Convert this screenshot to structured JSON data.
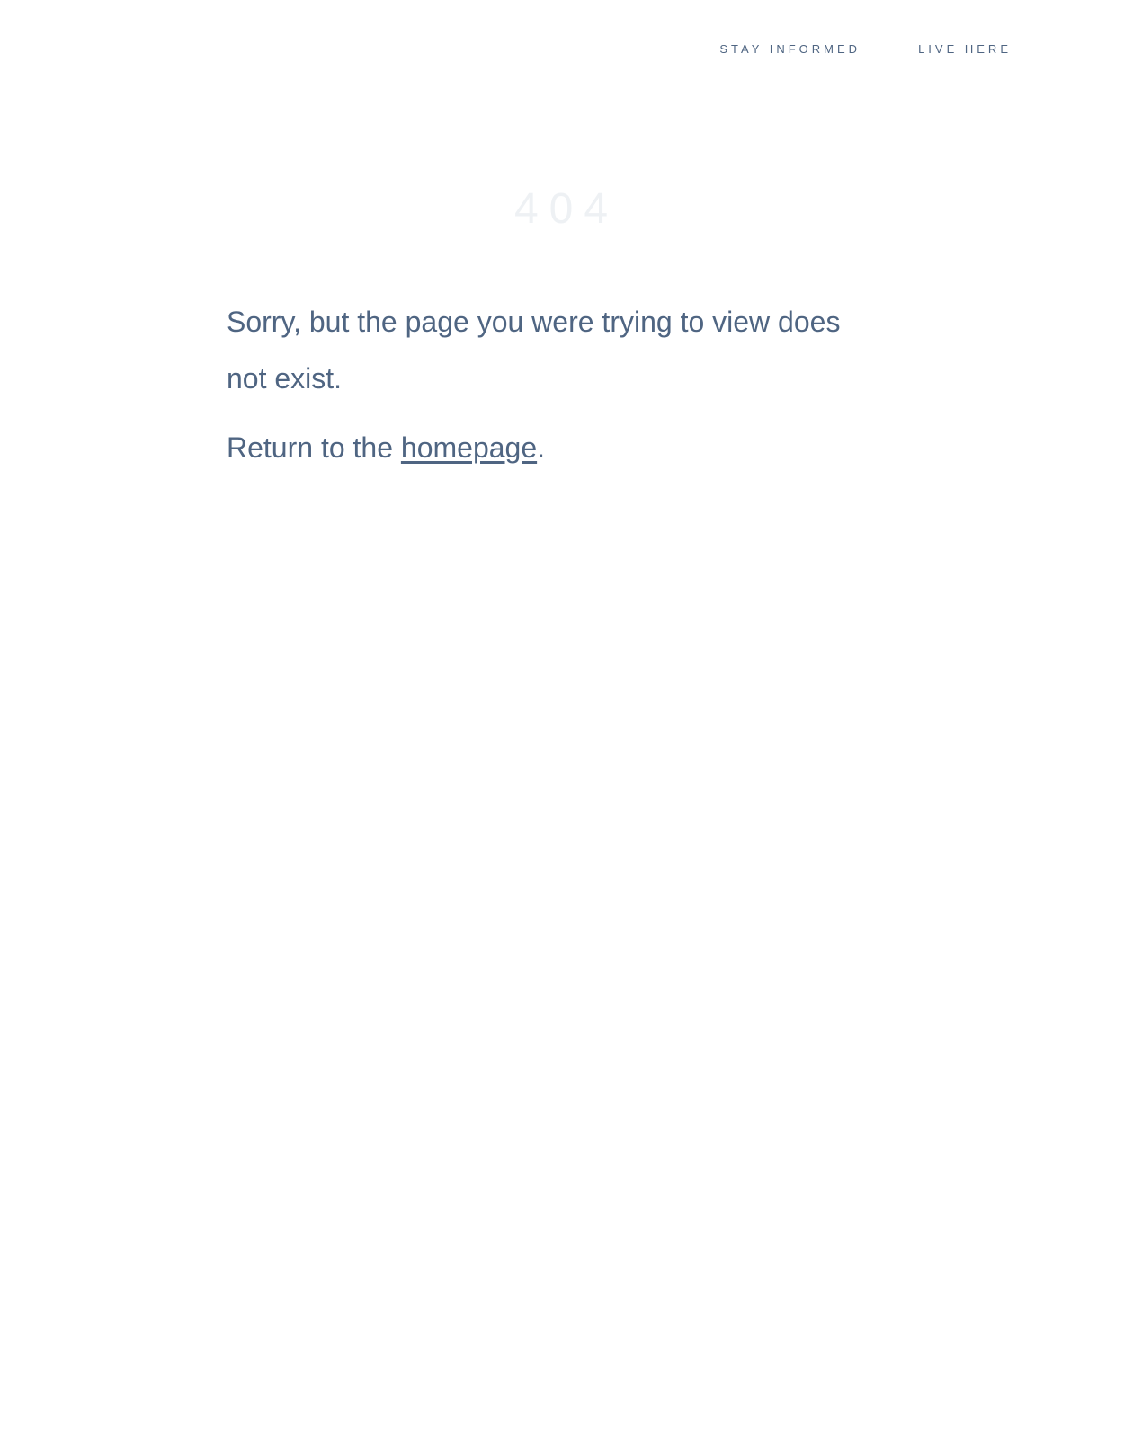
{
  "nav": {
    "items": [
      {
        "label": "STAY INFORMED"
      },
      {
        "label": "LIVE HERE"
      }
    ]
  },
  "error": {
    "code": "404",
    "message": "Sorry, but the page you were trying to view does not exist.",
    "return_prefix": "Return to the ",
    "return_link": "homepage",
    "return_suffix": "."
  },
  "colors": {
    "text": "#4f6582",
    "code": "#eef1f4",
    "background": "#ffffff"
  }
}
